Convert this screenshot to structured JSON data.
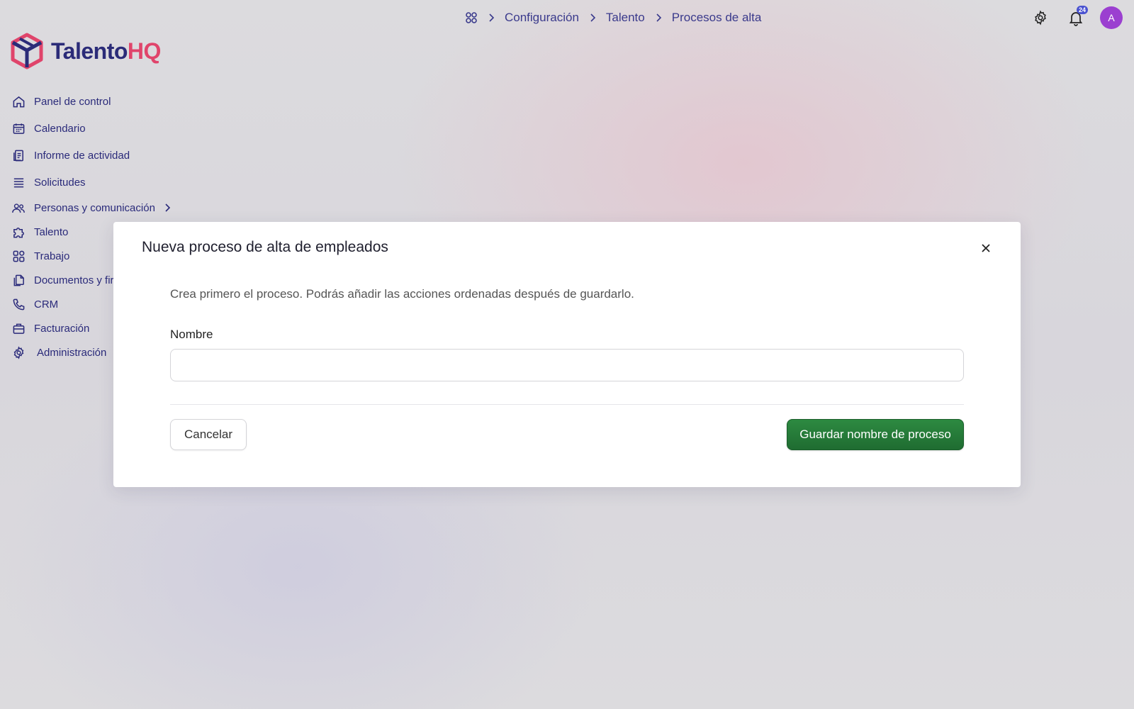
{
  "breadcrumb": {
    "home_icon": "apps-grid-icon",
    "items": [
      "Configuración",
      "Talento",
      "Procesos de alta"
    ]
  },
  "topbar": {
    "settings_icon": "gear-icon",
    "notifications_icon": "bell-icon",
    "notifications_count": "24",
    "avatar_initial": "A"
  },
  "logo": {
    "part1": "Talento",
    "part2": "HQ",
    "color_primary": "#2b2b78",
    "color_accent": "#e0446b"
  },
  "sidebar": {
    "items": [
      {
        "label": "Panel de control",
        "icon": "home-icon"
      },
      {
        "label": "Calendario",
        "icon": "calendar-icon"
      },
      {
        "label": "Informe de actividad",
        "icon": "report-icon"
      },
      {
        "label": "Solicitudes",
        "icon": "list-icon"
      },
      {
        "label": "Personas y comunicación",
        "icon": "people-icon"
      },
      {
        "label": "Talento",
        "icon": "puzzle-icon"
      },
      {
        "label": "Trabajo",
        "icon": "grid-icon"
      },
      {
        "label": "Documentos y fir",
        "icon": "documents-icon"
      },
      {
        "label": "CRM",
        "icon": "phone-icon"
      },
      {
        "label": "Facturación",
        "icon": "briefcase-icon"
      },
      {
        "label": "Administración",
        "icon": "gear-icon"
      }
    ]
  },
  "modal": {
    "title": "Nueva proceso de alta de empleados",
    "description": "Crea primero el proceso. Podrás añadir las acciones ordenadas después de guardarlo.",
    "name_label": "Nombre",
    "name_value": "",
    "cancel_label": "Cancelar",
    "save_label": "Guardar nombre de proceso",
    "save_color": "#237535"
  }
}
